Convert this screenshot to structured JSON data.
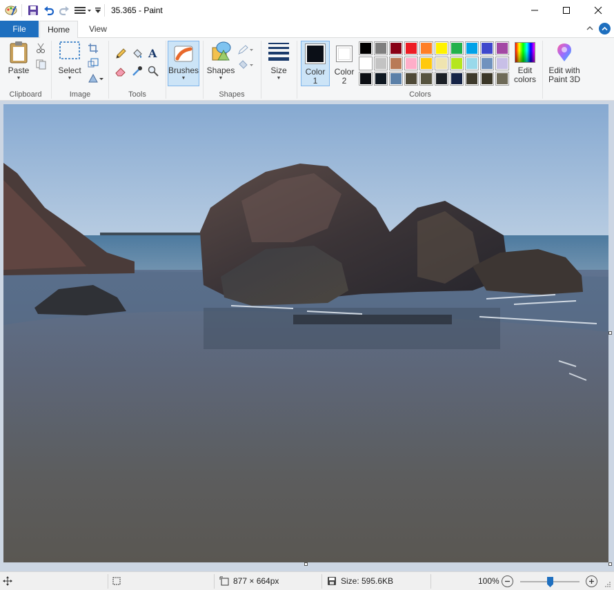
{
  "window": {
    "title": "35.365 - Paint"
  },
  "tabs": {
    "file": "File",
    "home": "Home",
    "view": "View"
  },
  "ribbon": {
    "clipboard": {
      "paste": "Paste",
      "group": "Clipboard"
    },
    "image": {
      "select": "Select",
      "group": "Image"
    },
    "tools": {
      "group": "Tools"
    },
    "brushes": {
      "label": "Brushes"
    },
    "shapes": {
      "label": "Shapes",
      "group": "Shapes"
    },
    "size": {
      "label": "Size"
    },
    "colors": {
      "color1_line1": "Color",
      "color1_line2": "1",
      "color2_line1": "Color",
      "color2_line2": "2",
      "edit_line1": "Edit",
      "edit_line2": "colors",
      "group": "Colors",
      "color1": "#0b0f17",
      "color2": "#ffffff",
      "palette_row1": [
        "#000000",
        "#7f7f7f",
        "#880015",
        "#ed1c24",
        "#ff7f27",
        "#fff200",
        "#22b14c",
        "#00a2e8",
        "#3f48cc",
        "#a349a4"
      ],
      "palette_row2": [
        "#ffffff",
        "#c3c3c3",
        "#b97a57",
        "#ffaec9",
        "#ffc90e",
        "#efe4b0",
        "#b5e61d",
        "#99d9ea",
        "#7092be",
        "#c8bfe7"
      ],
      "palette_row3": [
        "#0d1015",
        "#0f1822",
        "#5b80a8",
        "#4f4a38",
        "#575440",
        "#1b2026",
        "#162447",
        "#3e3a2c",
        "#3b3728",
        "#6e6a58"
      ]
    },
    "paint3d": {
      "line1": "Edit with",
      "line2": "Paint 3D"
    }
  },
  "status": {
    "dimensions": "877 × 664px",
    "size": "Size: 595.6KB",
    "zoom": "100%",
    "zoom_level": 0.5
  }
}
